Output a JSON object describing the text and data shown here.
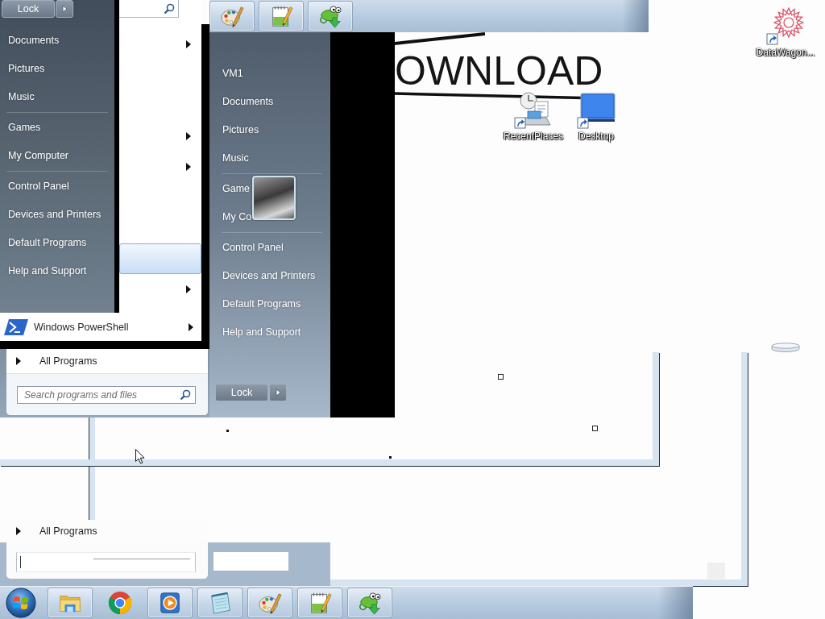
{
  "menu_left": {
    "lock_button": "Lock",
    "groups": [
      [
        "Documents",
        "Pictures",
        "Music"
      ],
      [
        "Games",
        "My Computer"
      ],
      [
        "Control Panel",
        "Devices and Printers",
        "Default Programs",
        "Help and Support"
      ]
    ]
  },
  "program_list": {
    "rows": [
      {
        "submenu": true,
        "selected": false
      },
      {
        "submenu": false,
        "selected": false
      },
      {
        "submenu": false,
        "selected": false
      },
      {
        "submenu": true,
        "selected": false
      },
      {
        "submenu": true,
        "selected": false
      },
      {
        "submenu": false,
        "selected": false
      },
      {
        "submenu": false,
        "selected": false
      },
      {
        "submenu": false,
        "selected": true
      },
      {
        "submenu": true,
        "selected": false
      }
    ]
  },
  "powershell_item": {
    "label": "Windows PowerShell",
    "submenu": true
  },
  "start_bottom": {
    "all_programs": "All Programs",
    "search_placeholder": "Search programs and files"
  },
  "top_taskbar": {
    "buttons": [
      {
        "kind": "paint",
        "running": true
      },
      {
        "kind": "notepadpp",
        "running": true
      },
      {
        "kind": "chameleon",
        "running": true
      }
    ]
  },
  "menu_right": {
    "groups": [
      [
        "VM1",
        "Documents",
        "Pictures",
        "Music"
      ],
      [
        "Game",
        "My Co"
      ],
      [
        "Control Panel",
        "Devices and Printers",
        "Default Programs",
        "Help and Support"
      ]
    ],
    "lock_button": "Lock"
  },
  "wallpaper": {
    "text": "OWNLOAD"
  },
  "desktop_icons": [
    {
      "label": "RecentPlaces",
      "kind": "recent"
    },
    {
      "label": "Desktop",
      "kind": "desktop"
    },
    {
      "label": "DataWagon...",
      "kind": "datawagon"
    }
  ],
  "ghost_menu": {
    "all_programs": "All Programs"
  },
  "taskbar": {
    "buttons": [
      {
        "kind": "folder",
        "running": true
      },
      {
        "kind": "chrome",
        "running": false
      },
      {
        "kind": "media",
        "running": true
      },
      {
        "kind": "notepad",
        "running": true
      },
      {
        "kind": "paint",
        "running": true
      },
      {
        "kind": "notepadpp",
        "running": true
      },
      {
        "kind": "chameleon",
        "running": true
      }
    ]
  }
}
